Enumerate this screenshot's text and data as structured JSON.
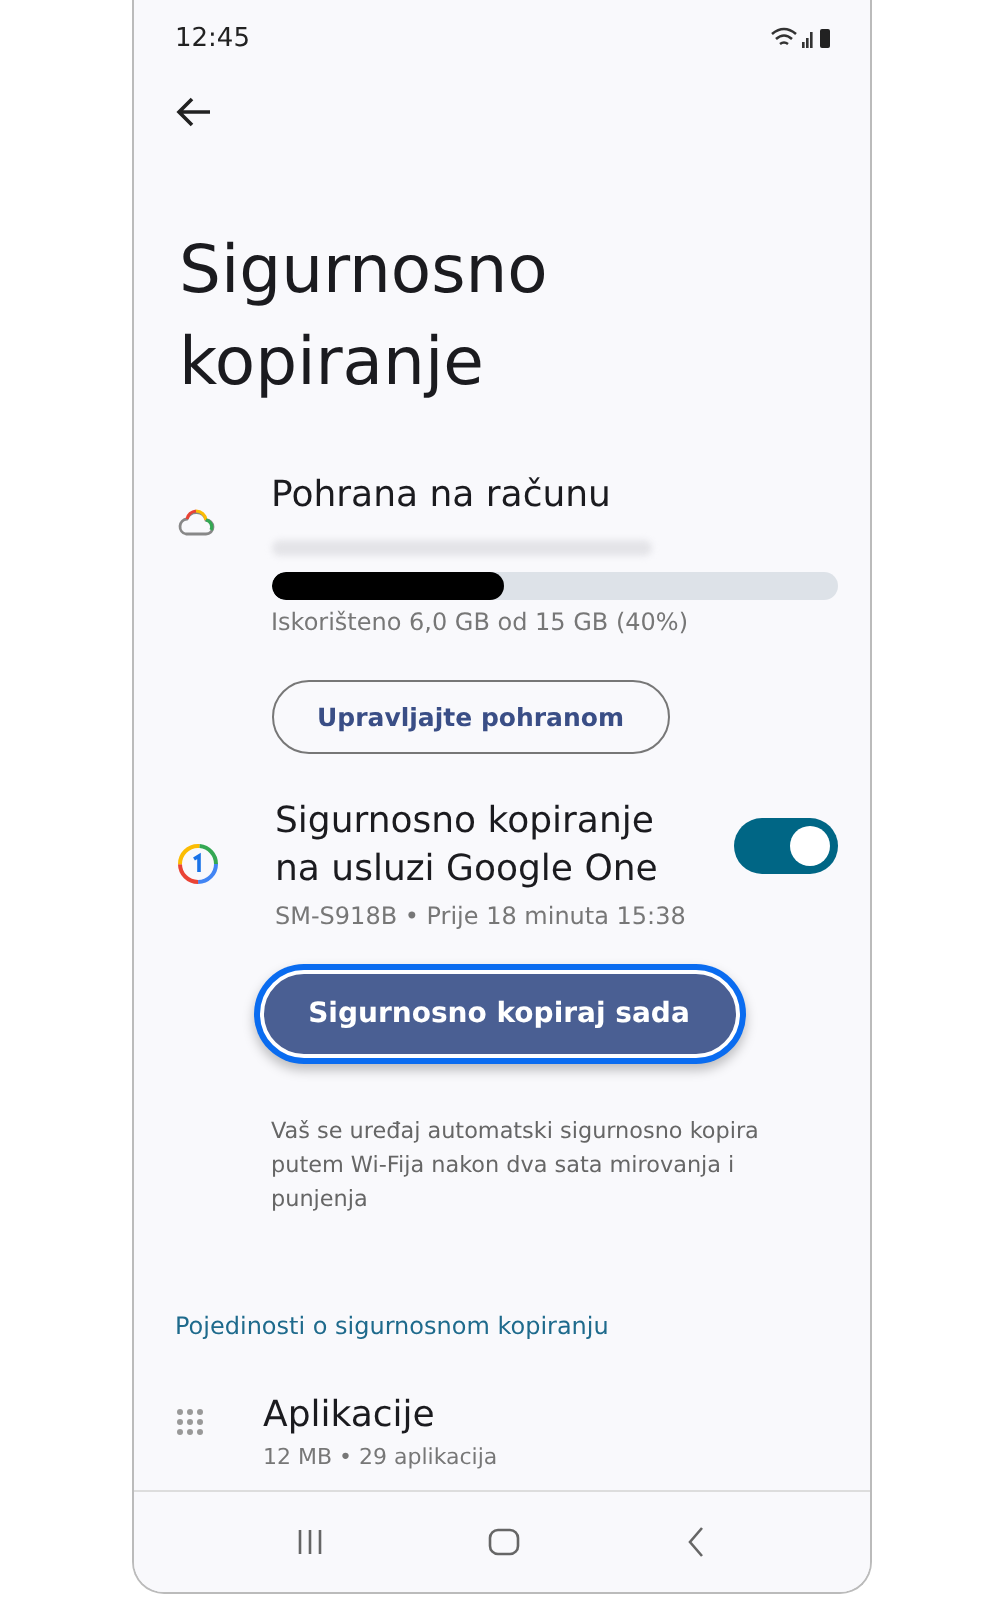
{
  "status_bar": {
    "time": "12:45"
  },
  "title": "Sigurnosno kopiranje",
  "storage": {
    "title": "Pohrana na računu",
    "level": 0.41,
    "usage": "Iskorišteno 6,0 GB od 15 GB (40%)",
    "manage_button": "Upravljajte pohranom"
  },
  "google_one": {
    "title": "Sigurnosno kopiranje na usluzi Google One",
    "on": true,
    "subtitle": "SM-S918B • Prije 18 minuta 15:38"
  },
  "backup_button": {
    "label": "Sigurnosno kopiraj sada",
    "focused": true
  },
  "note": "Vaš se uređaj automatski sigurnosno kopira putem Wi-Fija nakon dva sata mirovanja i punjenja",
  "details_link": "Pojedinosti o sigurnosnom kopiranju",
  "items": [
    {
      "title": "Aplikacije",
      "subtitle": "12 MB • 29 aplikacija"
    }
  ]
}
